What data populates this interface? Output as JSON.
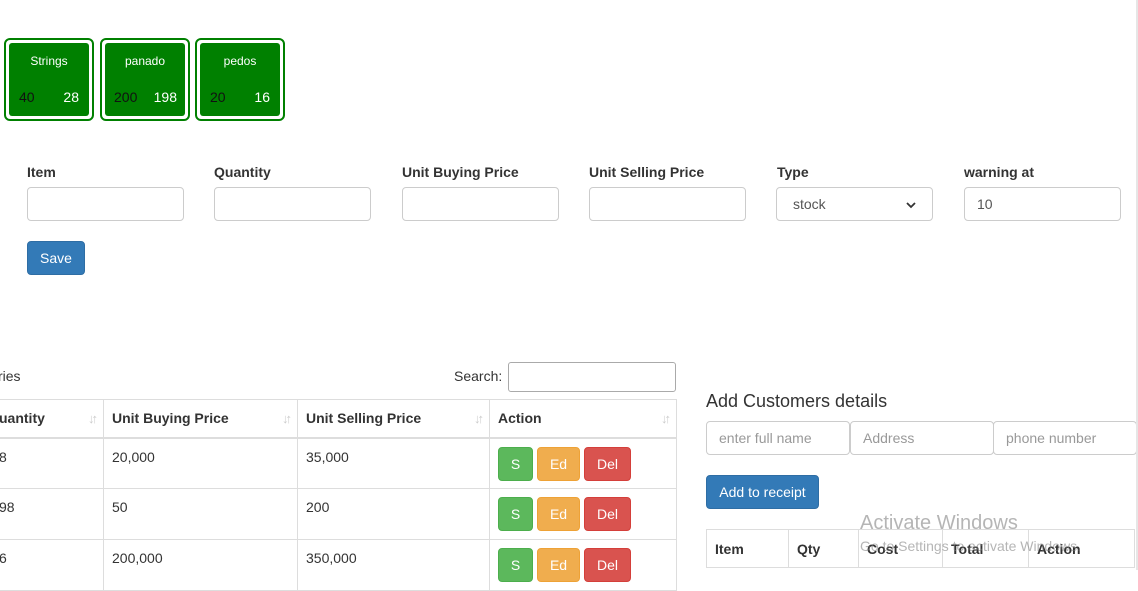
{
  "stock_cards": [
    {
      "name": "Strings",
      "total": "40",
      "remaining": "28"
    },
    {
      "name": "panado",
      "total": "200",
      "remaining": "198"
    },
    {
      "name": "pedos",
      "total": "20",
      "remaining": "16"
    }
  ],
  "form": {
    "labels": {
      "item": "Item",
      "quantity": "Quantity",
      "unit_buying_price": "Unit Buying Price",
      "unit_selling_price": "Unit Selling Price",
      "type": "Type",
      "warning_at": "warning at"
    },
    "values": {
      "item": "",
      "quantity": "",
      "unit_buying_price": "",
      "unit_selling_price": "",
      "type": "stock",
      "warning_at": "10"
    },
    "save_label": "Save"
  },
  "table": {
    "entries_fragment": "ries",
    "search_label": "Search:",
    "search_value": "",
    "columns": [
      "uantity",
      "Unit Buying Price",
      "Unit Selling Price",
      "Action"
    ],
    "sort_glyph": "↓↑",
    "rows": [
      {
        "quantity": "8",
        "buying": "20,000",
        "selling": "35,000"
      },
      {
        "quantity": "98",
        "buying": "50",
        "selling": "200"
      },
      {
        "quantity": "6",
        "buying": "200,000",
        "selling": "350,000"
      }
    ],
    "actions": {
      "sell": "S",
      "edit": "Ed",
      "delete": "Del"
    }
  },
  "customer": {
    "title": "Add Customers details",
    "placeholders": {
      "full_name": "enter full name",
      "address": "Address",
      "phone": "phone number"
    },
    "add_label": "Add to receipt"
  },
  "receipt": {
    "columns": [
      "Item",
      "Qty",
      "Cost",
      "Total",
      "Action"
    ]
  },
  "watermark": {
    "title": "Activate Windows",
    "subtitle": "Go to Settings to activate Windows."
  },
  "colors": {
    "card_green": "#008000",
    "primary": "#337ab7",
    "success": "#5cb85c",
    "warning": "#f0ad4e",
    "danger": "#d9534f"
  }
}
